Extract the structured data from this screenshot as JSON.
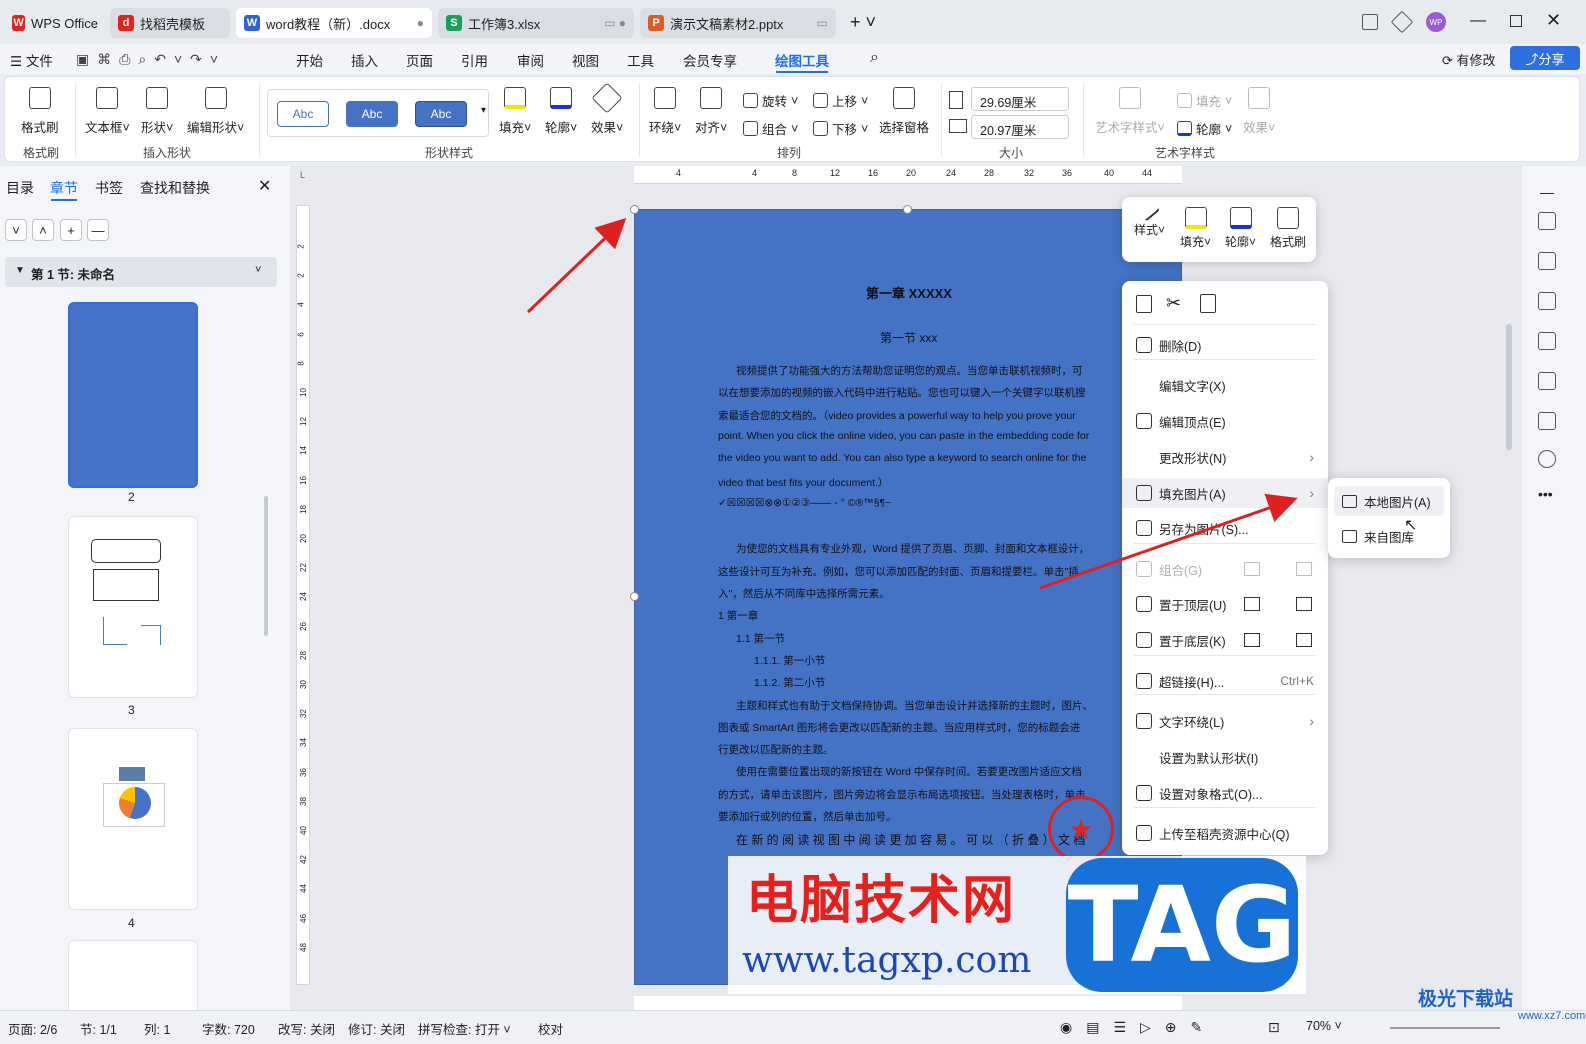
{
  "tabs": [
    {
      "label": "WPS Office",
      "icon": "W",
      "color": "#e8201c"
    },
    {
      "label": "找稻壳模板",
      "icon": "d",
      "color": "#e8201c"
    },
    {
      "label": "word教程（新）.docx",
      "icon": "W",
      "color": "#2b63d9"
    },
    {
      "label": "工作簿3.xlsx",
      "icon": "S",
      "color": "#18a058"
    },
    {
      "label": "演示文稿素材2.pptx",
      "icon": "P",
      "color": "#e25b21"
    }
  ],
  "user_badge": "WP",
  "menu": {
    "file": "文件",
    "items": [
      "开始",
      "插入",
      "页面",
      "引用",
      "审阅",
      "视图",
      "工具",
      "会员专享",
      "绘图工具"
    ],
    "active": "绘图工具",
    "modify": "有修改",
    "share": "分享"
  },
  "ribbon": {
    "format_painter": "格式刷",
    "group_format": "格式刷",
    "textbox": "文本框",
    "shape": "形状",
    "edit_shape": "编辑形状",
    "group_insert": "插入形状",
    "abc": [
      "Abc",
      "Abc",
      "Abc"
    ],
    "fill": "填充",
    "outline": "轮廓",
    "effect": "效果",
    "group_shape_style": "形状样式",
    "wrap": "环绕",
    "align": "对齐",
    "rotate": "旋转",
    "group": "组合",
    "up": "上移",
    "down": "下移",
    "selection_pane": "选择窗格",
    "group_arrange": "排列",
    "height": "29.69厘米",
    "width": "20.97厘米",
    "group_size": "大小",
    "art_style": "艺术字样式",
    "art_fill": "填充",
    "art_outline": "轮廓",
    "art_effect": "效果",
    "group_art": "艺术字样式"
  },
  "sidebar": {
    "tabs": [
      "目录",
      "章节",
      "书签",
      "查找和替换"
    ],
    "active_tab": "章节",
    "section": "第 1 节: 未命名",
    "pages": [
      "2",
      "3",
      "4"
    ]
  },
  "doc": {
    "title": "第一章  XXXXX",
    "subtitle": "第一节  xxx",
    "lines": [
      "视频提供了功能强大的方法帮助您证明您的观点。当您单击联机视频时，可",
      "以在想要添加的视频的嵌入代码中进行粘贴。您也可以键入一个关键字以联机搜",
      "索最适合您的文档的。（video provides a powerful way to help you prove your",
      "point. When you click the online video, you can paste in the embedding code for",
      "the video you want to add. You can also type a keyword to search online for the",
      "video that best fits your document.）",
      "✓☒☒☒☒⊗⊗①②③—— -    °  ©®™§¶~",
      "",
      "为使您的文档具有专业外观，Word 提供了页眉、页脚、封面和文本框设计，",
      "这些设计可互为补充。例如，您可以添加匹配的封面、页眉和提要栏。单击\"插",
      "入\"，然后从不同库中选择所需元素。",
      "1    第一章",
      "1.1    第一节",
      "1.1.1.    第一小节",
      "1.1.2.    第二小节",
      "主题和样式也有助于文档保持协调。当您单击设计并选择新的主题时，图片、",
      "图表或 SmartArt 图形将会更改以匹配新的主题。当应用样式时，您的标题会进",
      "行更改以匹配新的主题。",
      "使用在需要位置出现的新按钮在 Word 中保存时间。若要更改图片适应文档",
      "的方式，请单击该图片，图片旁边将会显示布局选项按钮。当处理表格时，单击",
      "要添加行或列的位置，然后单击加号。",
      "在 新 的 阅 读 视 图 中 阅 读 更 加 容 易 。 可 以 （ 折 叠 ） 文 档"
    ]
  },
  "minitool": [
    "样式",
    "填充",
    "轮廓",
    "格式刷"
  ],
  "context_menu": [
    {
      "label": "删除(D)",
      "icon": "trash-icon",
      "enabled": true
    },
    {
      "label": "编辑文字(X)",
      "icon": "",
      "enabled": true
    },
    {
      "label": "编辑顶点(E)",
      "icon": "vertex-icon",
      "enabled": true
    },
    {
      "label": "更改形状(N)",
      "icon": "",
      "enabled": true,
      "submenu": true
    },
    {
      "label": "填充图片(A)",
      "icon": "image-fill-icon",
      "enabled": true,
      "submenu": true
    },
    {
      "label": "另存为图片(S)...",
      "icon": "save-image-icon",
      "enabled": true
    },
    {
      "label": "组合(G)",
      "icon": "group-icon",
      "enabled": false
    },
    {
      "label": "置于顶层(U)",
      "icon": "bring-front-icon",
      "enabled": true
    },
    {
      "label": "置于底层(K)",
      "icon": "send-back-icon",
      "enabled": true
    },
    {
      "label": "超链接(H)...",
      "icon": "link-icon",
      "enabled": true,
      "shortcut": "Ctrl+K"
    },
    {
      "label": "文字环绕(L)",
      "icon": "wrap-icon",
      "enabled": true,
      "submenu": true
    },
    {
      "label": "设置为默认形状(I)",
      "icon": "",
      "enabled": true
    },
    {
      "label": "设置对象格式(O)...",
      "icon": "format-icon",
      "enabled": true
    },
    {
      "label": "上传至稻壳资源中心(Q)",
      "icon": "upload-icon",
      "enabled": true
    }
  ],
  "submenu": [
    "本地图片(A)",
    "来自图库"
  ],
  "status": {
    "page": "页面: 2/6",
    "section": "节: 1/1",
    "col": "列: 1",
    "words": "字数: 720",
    "modify": "改写: 关闭",
    "revise": "修订: 关闭",
    "spell": "拼写检查: 打开",
    "proof": "校对",
    "zoom": "70%"
  },
  "watermark": {
    "red": "电脑技术网",
    "url": "www.tagxp.com",
    "tag": "TAG",
    "brand": "极光下载站",
    "brand_url": "www.xz7.com"
  },
  "ruler_h": [
    "4",
    "4",
    "8",
    "12",
    "16",
    "20",
    "24",
    "28",
    "32",
    "36",
    "40",
    "44"
  ],
  "ruler_v": [
    "2",
    "2",
    "4",
    "6",
    "8",
    "10",
    "12",
    "14",
    "16",
    "18",
    "20",
    "22",
    "24",
    "26",
    "28",
    "30",
    "32",
    "34",
    "36",
    "38",
    "40",
    "42",
    "44",
    "46",
    "48"
  ]
}
